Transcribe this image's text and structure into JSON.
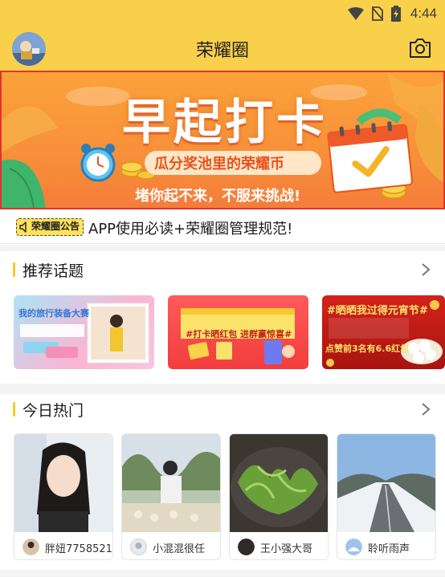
{
  "status_bar": {
    "time": "4:44"
  },
  "header": {
    "title": "荣耀圈"
  },
  "banner": {
    "title": "早起打卡",
    "subtitle": "瓜分奖池里的荣耀币",
    "slogan": "堵你起不来，不服来挑战!"
  },
  "notice": {
    "tag": "荣耀圈公告",
    "text": "APP使用必读+荣耀圈管理规范!"
  },
  "recommended": {
    "title": "推荐话题",
    "topics": [
      {
        "text": "我的旅行装备大赛"
      },
      {
        "text": "#打卡晒红包 进群赢惊喜#"
      },
      {
        "text": "#晒晒我过得元宵节#",
        "sub": "点赞前3名有6.6红包"
      }
    ]
  },
  "hot": {
    "title": "今日热门",
    "posts": [
      {
        "user": "胖妞7758521"
      },
      {
        "user": "小混混很任"
      },
      {
        "user": "王小强大哥"
      },
      {
        "user": "聆听雨声"
      }
    ]
  },
  "colors": {
    "brand_yellow": "#f9d04a",
    "banner_orange": "#f8923a",
    "accent_red": "#e3322c"
  }
}
